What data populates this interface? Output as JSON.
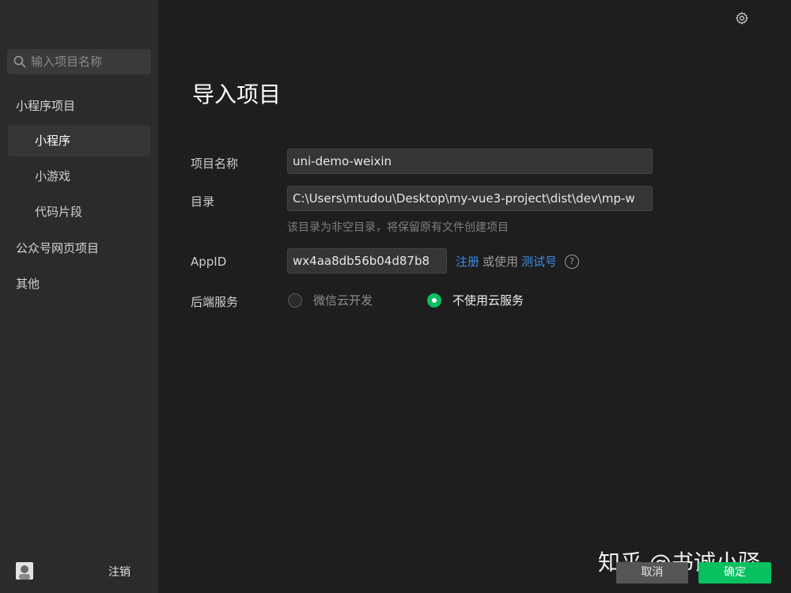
{
  "sidebar": {
    "search_placeholder": "输入项目名称",
    "sections": [
      {
        "label": "小程序项目"
      },
      {
        "label": "公众号网页项目"
      },
      {
        "label": "其他"
      }
    ],
    "items": [
      {
        "label": "小程序",
        "active": true
      },
      {
        "label": "小游戏",
        "active": false
      },
      {
        "label": "代码片段",
        "active": false
      }
    ],
    "logout_label": "注销"
  },
  "main": {
    "title": "导入项目",
    "form": {
      "name_label": "项目名称",
      "name_value": "uni-demo-weixin",
      "dir_label": "目录",
      "dir_value": "C:\\Users\\mtudou\\Desktop\\my-vue3-project\\dist\\dev\\mp-w",
      "dir_hint": "该目录为非空目录，将保留原有文件创建项目",
      "appid_label": "AppID",
      "appid_value": "wx4aa8db56b04d87b8",
      "register_link": "注册",
      "or_use_text": "或使用",
      "test_id_link": "测试号",
      "backend_label": "后端服务",
      "backend_options": [
        {
          "label": "微信云开发",
          "selected": false
        },
        {
          "label": "不使用云服务",
          "selected": true
        }
      ]
    },
    "buttons": {
      "cancel_label": "取消",
      "confirm_label": "确定"
    }
  },
  "watermark": "知乎 @书诚小驿",
  "colors": {
    "sidebar_bg": "#2b2b2b",
    "main_bg": "#1e1e1e",
    "accent_green": "#07c160",
    "link_blue": "#3b8de6"
  },
  "icons": {
    "search": "search-icon",
    "settings": "gear-icon",
    "help": "help-icon"
  }
}
